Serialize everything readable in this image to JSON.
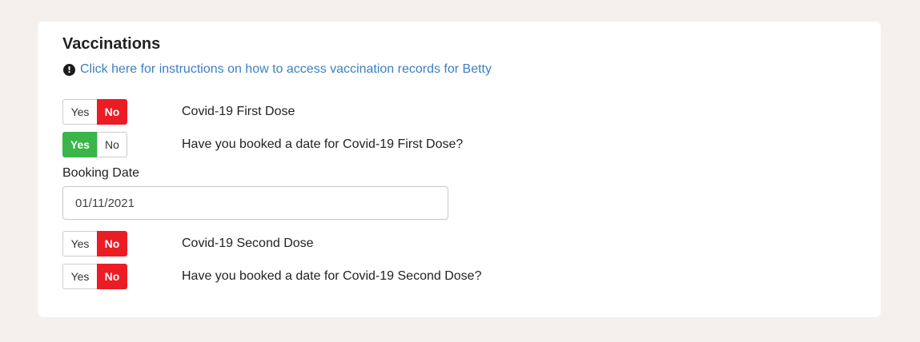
{
  "section": {
    "title": "Vaccinations",
    "info_link": "Click here for instructions on how to access vaccination records for Betty",
    "info_icon": "exclamation-circle-icon"
  },
  "questions": [
    {
      "yes_label": "Yes",
      "no_label": "No",
      "selected": "No",
      "label": "Covid-19 First Dose"
    },
    {
      "yes_label": "Yes",
      "no_label": "No",
      "selected": "Yes",
      "label": "Have you booked a date for Covid-19 First Dose?"
    },
    {
      "yes_label": "Yes",
      "no_label": "No",
      "selected": "No",
      "label": "Covid-19 Second Dose"
    },
    {
      "yes_label": "Yes",
      "no_label": "No",
      "selected": "No",
      "label": "Have you booked a date for Covid-19 Second Dose?"
    }
  ],
  "booking_date": {
    "label": "Booking Date",
    "value": "01/11/2021"
  },
  "colors": {
    "yes_active": "#39b54a",
    "no_active": "#ec1c24",
    "link": "#3d7fc1",
    "background": "#f3f0ed"
  }
}
